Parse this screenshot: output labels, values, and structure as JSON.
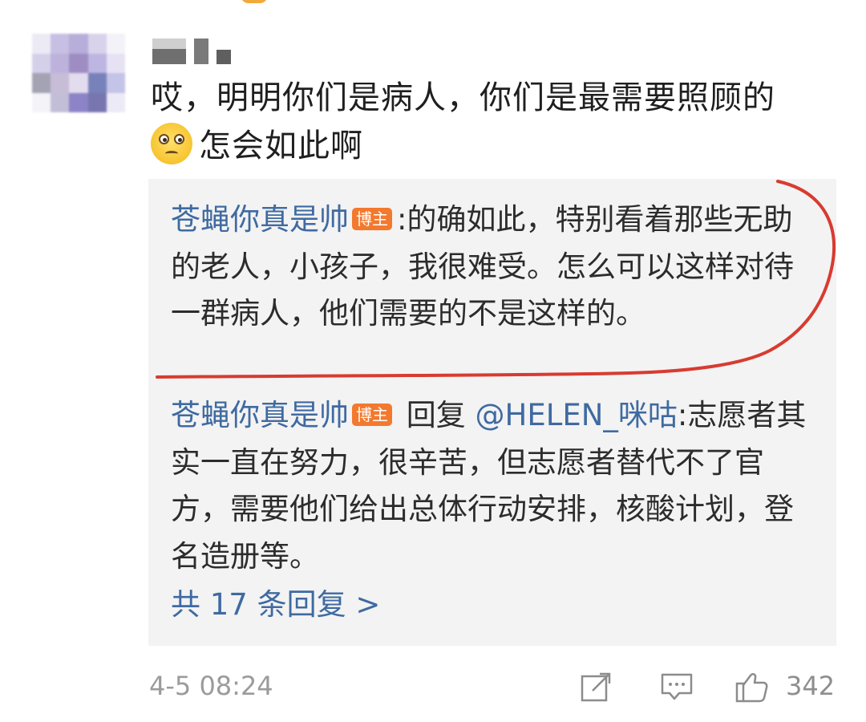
{
  "comment": {
    "line1": "哎，明明你们是病人，你们是最需要照顾的",
    "line2": "怎会如此啊",
    "emoji_icon": "pleading-face-icon"
  },
  "replies": [
    {
      "author": "苍蝇你真是帅",
      "badge": "博主",
      "text": ":的确如此，特别看着那些无助的老人，小孩子，我很难受。怎么可以这样对待一群病人，他们需要的不是这样的。"
    },
    {
      "author": "苍蝇你真是帅",
      "badge": "博主",
      "reply_prefix": " 回复 ",
      "mention": "@HELEN_咪咕",
      "text": ":志愿者其实一直在努力，很辛苦，但志愿者替代不了官方，需要他们给出总体行动安排，核酸计划，登名造册等。"
    }
  ],
  "more_replies": "共 17 条回复 >",
  "footer": {
    "timestamp": "4-5 08:24",
    "like_count": "342",
    "share_icon": "share-icon",
    "comment_icon": "comment-icon",
    "like_icon": "thumbs-up-icon"
  },
  "colors": {
    "link": "#3f6aa1",
    "badge": "#f3792e",
    "annotation": "#d83b30",
    "reply_bg": "#f3f3f3"
  }
}
